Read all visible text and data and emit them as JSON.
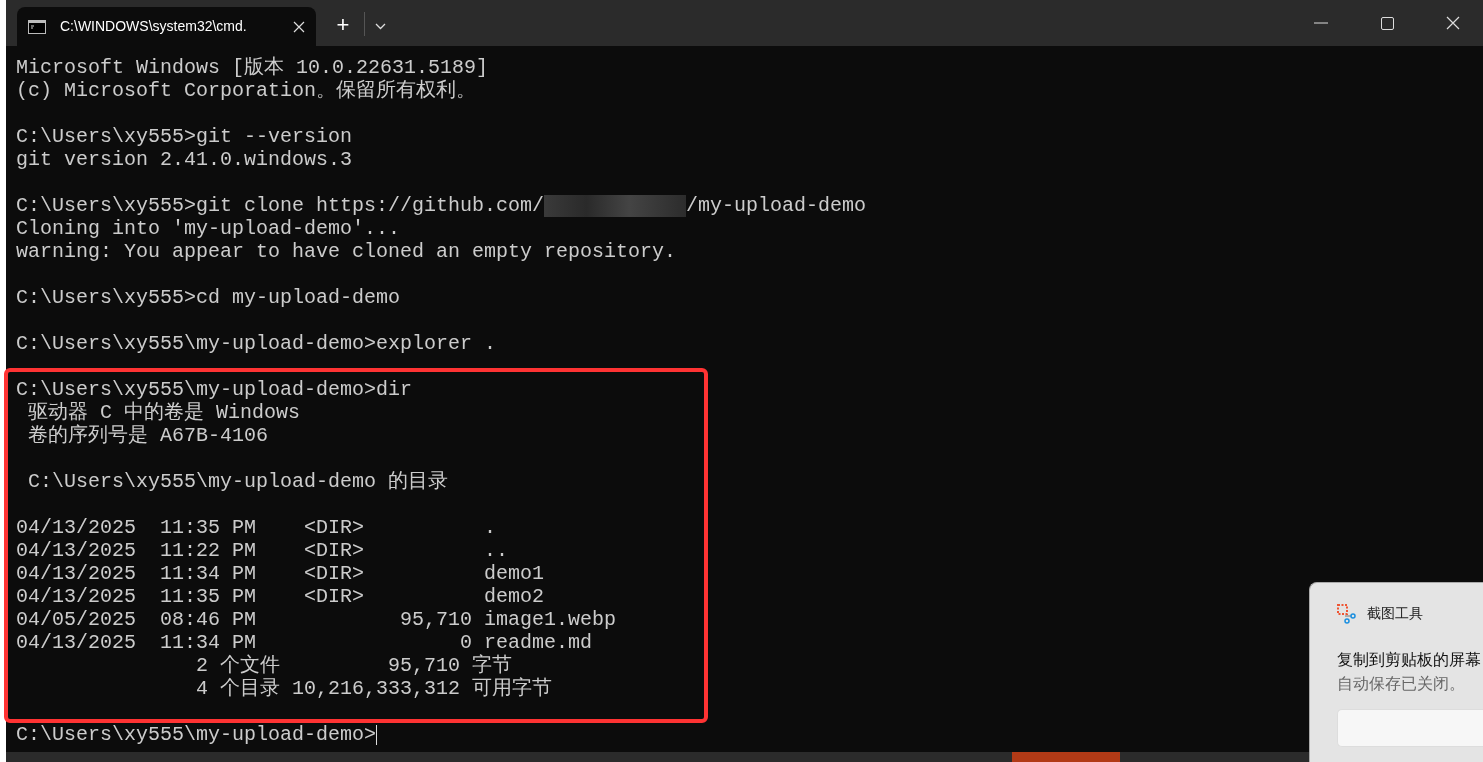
{
  "window": {
    "tab_title": "C:\\WINDOWS\\system32\\cmd.",
    "new_tab": "+"
  },
  "terminal": {
    "lines": [
      {
        "kind": "text",
        "text": "Microsoft Windows [版本 10.0.22631.5189]"
      },
      {
        "kind": "text",
        "text": "(c) Microsoft Corporation。保留所有权利。"
      },
      {
        "kind": "blank"
      },
      {
        "kind": "text",
        "text": "C:\\Users\\xy555>git --version"
      },
      {
        "kind": "text",
        "text": "git version 2.41.0.windows.3"
      },
      {
        "kind": "blank"
      },
      {
        "kind": "redacted",
        "before": "C:\\Users\\xy555>git clone https://github.com/",
        "after": "/my-upload-demo"
      },
      {
        "kind": "text",
        "text": "Cloning into 'my-upload-demo'..."
      },
      {
        "kind": "text",
        "text": "warning: You appear to have cloned an empty repository."
      },
      {
        "kind": "blank"
      },
      {
        "kind": "text",
        "text": "C:\\Users\\xy555>cd my-upload-demo"
      },
      {
        "kind": "blank"
      },
      {
        "kind": "text",
        "text": "C:\\Users\\xy555\\my-upload-demo>explorer ."
      },
      {
        "kind": "blank"
      },
      {
        "kind": "text",
        "text": "C:\\Users\\xy555\\my-upload-demo>dir"
      },
      {
        "kind": "text",
        "text": " 驱动器 C 中的卷是 Windows"
      },
      {
        "kind": "text",
        "text": " 卷的序列号是 A67B-4106"
      },
      {
        "kind": "blank"
      },
      {
        "kind": "text",
        "text": " C:\\Users\\xy555\\my-upload-demo 的目录"
      },
      {
        "kind": "blank"
      },
      {
        "kind": "text",
        "text": "04/13/2025  11:35 PM    <DIR>          ."
      },
      {
        "kind": "text",
        "text": "04/13/2025  11:22 PM    <DIR>          .."
      },
      {
        "kind": "text",
        "text": "04/13/2025  11:34 PM    <DIR>          demo1"
      },
      {
        "kind": "text",
        "text": "04/13/2025  11:35 PM    <DIR>          demo2"
      },
      {
        "kind": "text",
        "text": "04/05/2025  08:46 PM            95,710 image1.webp"
      },
      {
        "kind": "text",
        "text": "04/13/2025  11:34 PM                 0 readme.md"
      },
      {
        "kind": "text",
        "text": "               2 个文件         95,710 字节"
      },
      {
        "kind": "text",
        "text": "               4 个目录 10,216,333,312 可用字节"
      },
      {
        "kind": "blank"
      },
      {
        "kind": "prompt",
        "text": "C:\\Users\\xy555\\my-upload-demo>"
      }
    ]
  },
  "notification": {
    "app": "截图工具",
    "message": "复制到剪贴板的屏幕",
    "detail": "自动保存已关闭。"
  }
}
